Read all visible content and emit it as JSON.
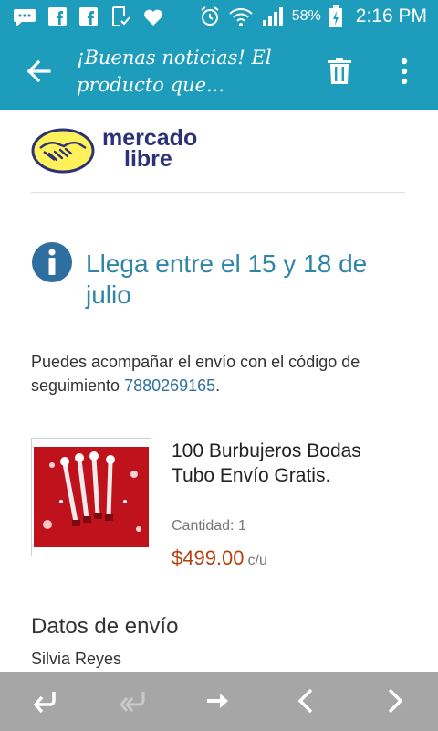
{
  "status_bar": {
    "battery": "58%",
    "time": "2:16 PM",
    "icons": [
      "message-icon",
      "facebook-icon",
      "facebook-icon",
      "document-check-icon",
      "heart-icon",
      "alarm-icon",
      "wifi-icon",
      "signal-icon",
      "battery-charging-icon"
    ]
  },
  "app_bar": {
    "title": "¡Buenas noticias! El producto que...",
    "background": "#1d9dbb",
    "actions": [
      "back-arrow-icon",
      "trash-icon",
      "more-vertical-icon"
    ]
  },
  "brand": {
    "line1": "mercado",
    "line2": "libre",
    "logo_color": "#fff159"
  },
  "delivery": {
    "headline": "Llega entre el 15 y 18 de julio",
    "tracking_prefix": "Puedes acompañar el envío con el código de seguimiento ",
    "tracking_code": "7880269165",
    "tracking_suffix": "."
  },
  "product": {
    "title": "100 Burbujeros Bodas Tubo Envío Gratis.",
    "quantity": "Cantidad: 1",
    "price": "$499.00",
    "price_unit": "c/u"
  },
  "shipping": {
    "section_title": "Datos de envío",
    "recipient": "Silvia Reyes"
  },
  "bottom_bar": {
    "buttons": [
      "reply-icon",
      "reply-all-icon",
      "forward-icon",
      "previous-icon",
      "next-icon"
    ]
  }
}
